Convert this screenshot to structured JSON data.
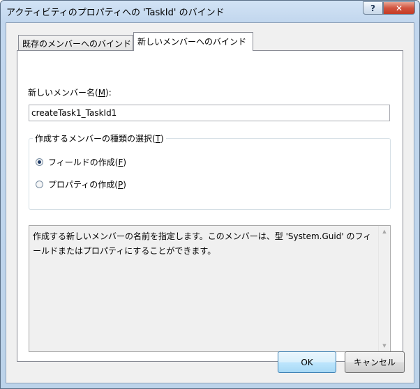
{
  "window": {
    "title": "アクティビティのプロパティへの 'TaskId' のバインド",
    "help_glyph": "?",
    "close_glyph": "✕"
  },
  "tabs": [
    {
      "label": "既存のメンバーへのバインド",
      "selected": false
    },
    {
      "label": "新しいメンバーへのバインド",
      "selected": true
    }
  ],
  "new_member": {
    "label_text": "新しいメンバー名(",
    "label_accel": "M",
    "label_end": "):",
    "value": "createTask1_TaskId1"
  },
  "member_type": {
    "legend_text": "作成するメンバーの種類の選択(",
    "legend_accel": "T",
    "legend_end": ")",
    "options": [
      {
        "text": "フィールドの作成(",
        "accel": "F",
        "end": ")",
        "checked": true
      },
      {
        "text": "プロパティの作成(",
        "accel": "P",
        "end": ")",
        "checked": false
      }
    ]
  },
  "description": "作成する新しいメンバーの名前を指定します。このメンバーは、型 'System.Guid' のフィールドまたはプロパティにすることができます。",
  "scroll": {
    "up_glyph": "▲",
    "down_glyph": "▼"
  },
  "buttons": {
    "ok": "OK",
    "cancel": "キャンセル"
  },
  "colors": {
    "title_gradient": "#c2d7ee",
    "close_button": "#c43a24",
    "ok_button": "#bee6fd"
  }
}
